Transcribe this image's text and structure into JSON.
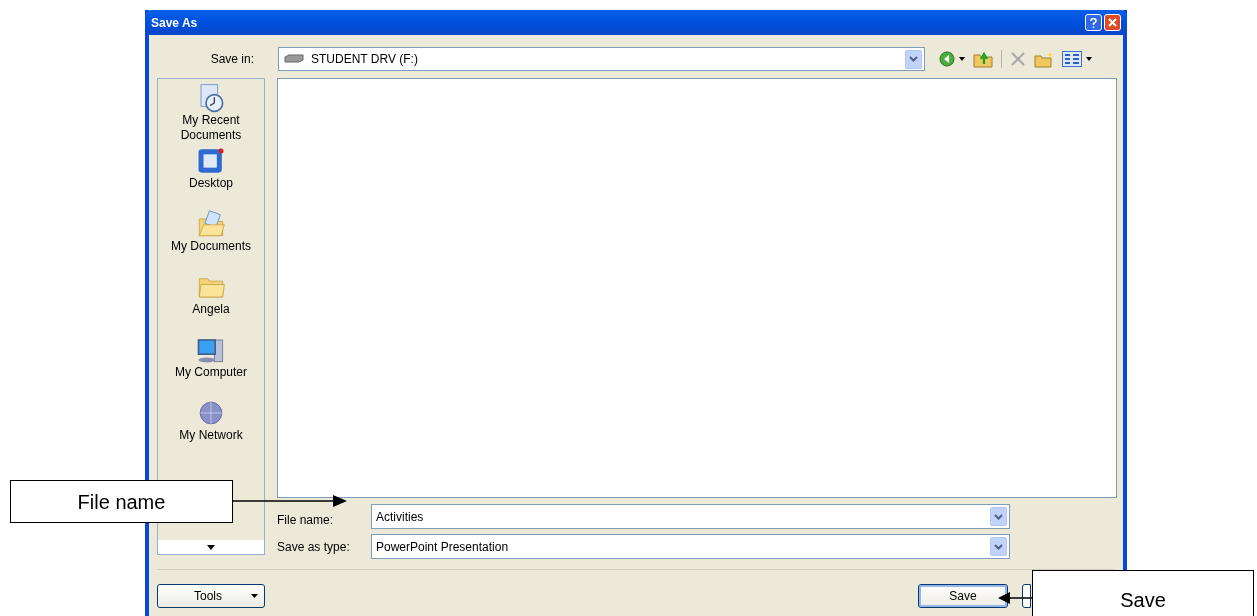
{
  "window": {
    "title": "Save As"
  },
  "save_in": {
    "label": "Save in:",
    "value": "STUDENT DRV (F:)"
  },
  "places": [
    {
      "label": "My Recent Documents",
      "kind": "recent"
    },
    {
      "label": "Desktop",
      "kind": "desktop"
    },
    {
      "label": "My Documents",
      "kind": "documents"
    },
    {
      "label": "Angela",
      "kind": "folder"
    },
    {
      "label": "My Computer",
      "kind": "computer"
    },
    {
      "label": "My Network",
      "kind": "network"
    }
  ],
  "file_name": {
    "label": "File name:",
    "value": "Activities"
  },
  "save_as_type": {
    "label": "Save as type:",
    "value": "PowerPoint Presentation"
  },
  "buttons": [
    {
      "label": "Tools",
      "kind": "menu"
    },
    {
      "label": "Save",
      "kind": "default"
    }
  ],
  "callouts": [
    {
      "text": "File name"
    },
    {
      "text": "Save"
    }
  ]
}
